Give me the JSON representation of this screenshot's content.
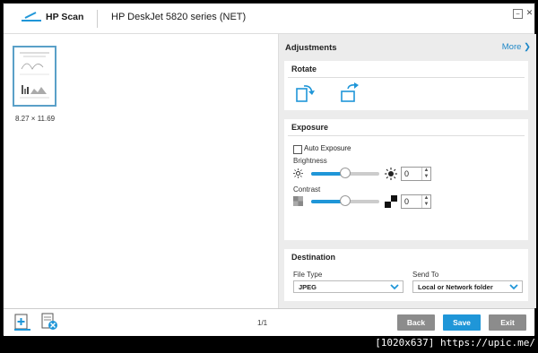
{
  "titlebar": {
    "app_name": "HP Scan",
    "device_name": "HP DeskJet 5820 series (NET)",
    "minimize_glyph": "−",
    "close_glyph": "✕"
  },
  "preview": {
    "page_size": "8.27 × 11.69"
  },
  "adjustments": {
    "title": "Adjustments",
    "more_label": "More ❯",
    "rotate": {
      "title": "Rotate"
    },
    "exposure": {
      "title": "Exposure",
      "auto_exposure_label": "Auto Exposure",
      "auto_exposure_checked": false,
      "brightness_label": "Brightness",
      "brightness_value": "0",
      "brightness_level": 0.5,
      "contrast_label": "Contrast",
      "contrast_value": "0",
      "contrast_level": 0.5
    },
    "destination": {
      "title": "Destination",
      "file_type_label": "File Type",
      "file_type_value": "JPEG",
      "send_to_label": "Send To",
      "send_to_value": "Local or Network folder"
    }
  },
  "footer": {
    "page_count": "1/1",
    "back_label": "Back",
    "save_label": "Save",
    "exit_label": "Exit"
  },
  "watermark": "[1020x637] https://upic.me/",
  "colors": {
    "accent": "#1f96d8",
    "link": "#1f88c8",
    "grey_button": "#8c8c8c"
  }
}
